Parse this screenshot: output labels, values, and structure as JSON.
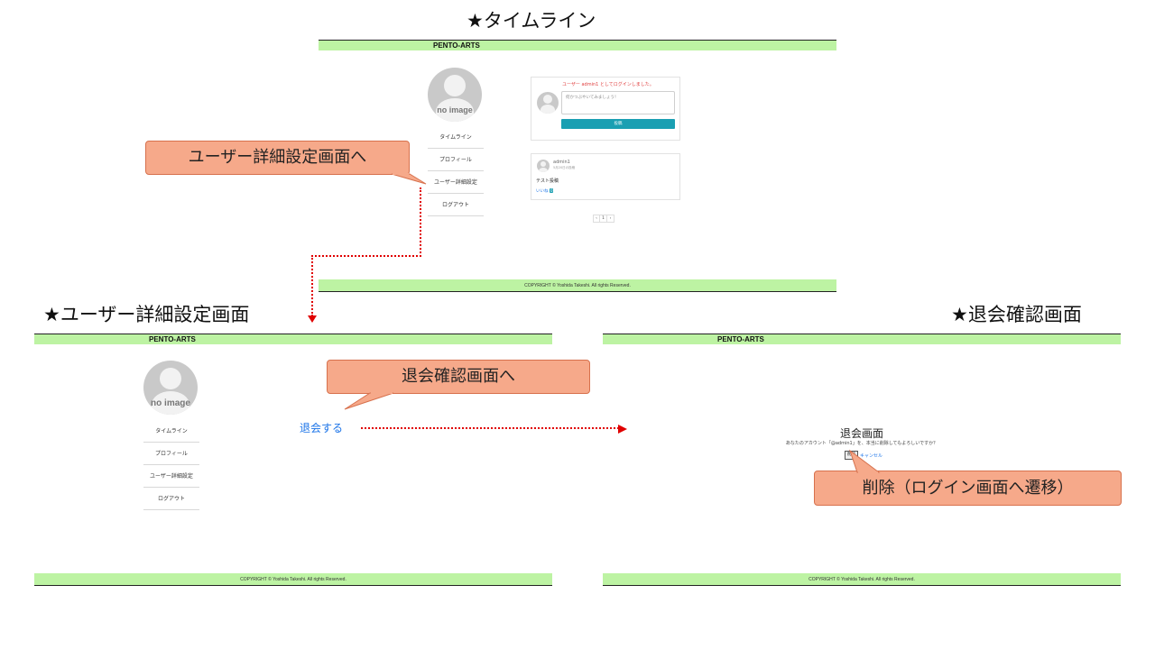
{
  "titles": {
    "timeline": "★タイムライン",
    "user_settings": "★ユーザー詳細設定画面",
    "withdraw_confirm": "★退会確認画面"
  },
  "app": {
    "brand": "PENTO-ARTS",
    "footer": "COPYRIGHT © Yoshida Takeshi. All rights Reserved.",
    "no_image": "no image"
  },
  "menu": [
    {
      "label": "タイムライン"
    },
    {
      "label": "プロフィール"
    },
    {
      "label": "ユーザー詳細設定"
    },
    {
      "label": "ログアウト"
    }
  ],
  "timeline": {
    "login_message": "ユーザー admin1 としてログインしました。",
    "post_placeholder": "何かつぶやいてみましょう！",
    "post_button": "投稿",
    "post": {
      "username": "admin1",
      "date": "5月20日の投稿",
      "text": "テスト投稿",
      "like_label": "いいね",
      "like_count": "0"
    },
    "pagination": [
      "‹",
      "1",
      "›"
    ]
  },
  "user_settings": {
    "withdraw_link": "退会する"
  },
  "withdraw": {
    "title": "退会画面",
    "message": "あなたのアカウント「@admin1」を、本当に削除してもよろしいですか？",
    "delete_button": "削除",
    "cancel_link": "キャンセル"
  },
  "callouts": {
    "to_user_settings": "ユーザー詳細設定画面へ",
    "to_withdraw": "退会確認画面へ",
    "delete_note": "削除（ログイン画面へ遷移）"
  },
  "colors": {
    "header_green": "#bdf3a3",
    "callout_fill": "#f6a98a",
    "arrow_red": "#e00000",
    "post_button": "#1a9fb2",
    "link_blue": "#1a73e8"
  }
}
